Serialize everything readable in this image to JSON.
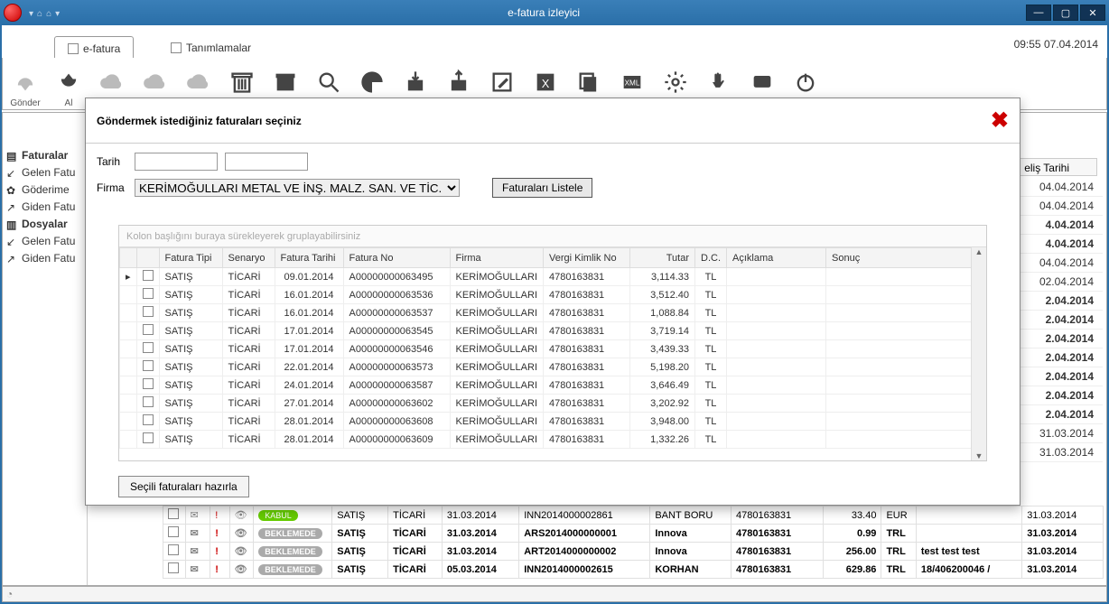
{
  "window": {
    "title": "e-fatura izleyici",
    "datetime": "09:55 07.04.2014"
  },
  "tabs": {
    "main": "e-fatura",
    "defs": "Tanımlamalar"
  },
  "ribbon": {
    "labels": {
      "send": "Gönder",
      "receive": "Al"
    }
  },
  "sidebar": {
    "header1": "Faturalar",
    "item1": "Gelen Fatu",
    "item2": "Göderime",
    "item3": "Giden Fatu",
    "header2": "Dosyalar",
    "item4": "Gelen Fatu",
    "item5": "Giden Fatu"
  },
  "back": {
    "colHeader": "eliş Tarihi",
    "rows": [
      {
        "date": "04.04.2014",
        "bold": false
      },
      {
        "date": "04.04.2014",
        "bold": false
      },
      {
        "date": "4.04.2014",
        "bold": true
      },
      {
        "date": "4.04.2014",
        "bold": true
      },
      {
        "date": "04.04.2014",
        "bold": false
      },
      {
        "date": "02.04.2014",
        "bold": false
      },
      {
        "date": "2.04.2014",
        "bold": true
      },
      {
        "date": "2.04.2014",
        "bold": true
      },
      {
        "date": "2.04.2014",
        "bold": true
      },
      {
        "date": "2.04.2014",
        "bold": true
      },
      {
        "date": "2.04.2014",
        "bold": true
      },
      {
        "date": "2.04.2014",
        "bold": true
      },
      {
        "date": "2.04.2014",
        "bold": true
      },
      {
        "date": "31.03.2014",
        "bold": false
      },
      {
        "date": "31.03.2014",
        "bold": false
      }
    ]
  },
  "modal": {
    "title": "Göndermek istediğiniz faturaları seçiniz",
    "labels": {
      "date": "Tarih",
      "firm": "Firma"
    },
    "firmValue": "KERİMOĞULLARI METAL VE İNŞ. MALZ.  SAN. VE TİC. LTD. ŞTİ.",
    "listBtn": "Faturaları Listele",
    "groupHint": "Kolon başlığını buraya sürekleyerek gruplayabilirsiniz",
    "columns": {
      "ftipi": "Fatura Tipi",
      "senaryo": "Senaryo",
      "ftarihi": "Fatura Tarihi",
      "fno": "Fatura No",
      "firma": "Firma",
      "vkn": "Vergi Kimlik No",
      "tutar": "Tutar",
      "dc": "D.C.",
      "aciklama": "Açıklama",
      "sonuc": "Sonuç"
    },
    "rows": [
      {
        "tip": "SATIŞ",
        "sen": "TİCARİ",
        "tar": "09.01.2014",
        "no": "A00000000063495",
        "firma": "KERİMOĞULLARI",
        "vkn": "4780163831",
        "tutar": "3,114.33",
        "dc": "TL"
      },
      {
        "tip": "SATIŞ",
        "sen": "TİCARİ",
        "tar": "16.01.2014",
        "no": "A00000000063536",
        "firma": "KERİMOĞULLARI",
        "vkn": "4780163831",
        "tutar": "3,512.40",
        "dc": "TL"
      },
      {
        "tip": "SATIŞ",
        "sen": "TİCARİ",
        "tar": "16.01.2014",
        "no": "A00000000063537",
        "firma": "KERİMOĞULLARI",
        "vkn": "4780163831",
        "tutar": "1,088.84",
        "dc": "TL"
      },
      {
        "tip": "SATIŞ",
        "sen": "TİCARİ",
        "tar": "17.01.2014",
        "no": "A00000000063545",
        "firma": "KERİMOĞULLARI",
        "vkn": "4780163831",
        "tutar": "3,719.14",
        "dc": "TL"
      },
      {
        "tip": "SATIŞ",
        "sen": "TİCARİ",
        "tar": "17.01.2014",
        "no": "A00000000063546",
        "firma": "KERİMOĞULLARI",
        "vkn": "4780163831",
        "tutar": "3,439.33",
        "dc": "TL"
      },
      {
        "tip": "SATIŞ",
        "sen": "TİCARİ",
        "tar": "22.01.2014",
        "no": "A00000000063573",
        "firma": "KERİMOĞULLARI",
        "vkn": "4780163831",
        "tutar": "5,198.20",
        "dc": "TL"
      },
      {
        "tip": "SATIŞ",
        "sen": "TİCARİ",
        "tar": "24.01.2014",
        "no": "A00000000063587",
        "firma": "KERİMOĞULLARI",
        "vkn": "4780163831",
        "tutar": "3,646.49",
        "dc": "TL"
      },
      {
        "tip": "SATIŞ",
        "sen": "TİCARİ",
        "tar": "27.01.2014",
        "no": "A00000000063602",
        "firma": "KERİMOĞULLARI",
        "vkn": "4780163831",
        "tutar": "3,202.92",
        "dc": "TL"
      },
      {
        "tip": "SATIŞ",
        "sen": "TİCARİ",
        "tar": "28.01.2014",
        "no": "A00000000063608",
        "firma": "KERİMOĞULLARI",
        "vkn": "4780163831",
        "tutar": "3,948.00",
        "dc": "TL"
      },
      {
        "tip": "SATIŞ",
        "sen": "TİCARİ",
        "tar": "28.01.2014",
        "no": "A00000000063609",
        "firma": "KERİMOĞULLARI",
        "vkn": "4780163831",
        "tutar": "1,332.26",
        "dc": "TL"
      }
    ],
    "prepareBtn": "Seçili faturaları hazırla"
  },
  "bottomGrid": {
    "rows": [
      {
        "bold": false,
        "status": "KABUL",
        "statusCls": "green",
        "tip": "SATIŞ",
        "sen": "TİCARİ",
        "tar": "31.03.2014",
        "no": "INN2014000002861",
        "firma": "BANT BORU",
        "vkn": "4780163831",
        "tutar": "33.40",
        "cur": "EUR",
        "acik": "",
        "gtar": "31.03.2014"
      },
      {
        "bold": true,
        "status": "BEKLEMEDE",
        "statusCls": "grey",
        "tip": "SATIŞ",
        "sen": "TİCARİ",
        "tar": "31.03.2014",
        "no": "ARS2014000000001",
        "firma": "Innova",
        "vkn": "4780163831",
        "tutar": "0.99",
        "cur": "TRL",
        "acik": "",
        "gtar": "31.03.2014"
      },
      {
        "bold": true,
        "status": "BEKLEMEDE",
        "statusCls": "grey",
        "tip": "SATIŞ",
        "sen": "TİCARİ",
        "tar": "31.03.2014",
        "no": "ART2014000000002",
        "firma": "Innova",
        "vkn": "4780163831",
        "tutar": "256.00",
        "cur": "TRL",
        "acik": "test test test",
        "gtar": "31.03.2014"
      },
      {
        "bold": true,
        "status": "BEKLEMEDE",
        "statusCls": "grey",
        "tip": "SATIŞ",
        "sen": "TİCARİ",
        "tar": "05.03.2014",
        "no": "INN2014000002615",
        "firma": "KORHAN",
        "vkn": "4780163831",
        "tutar": "629.86",
        "cur": "TRL",
        "acik": "18/406200046 /",
        "gtar": "31.03.2014"
      }
    ]
  }
}
